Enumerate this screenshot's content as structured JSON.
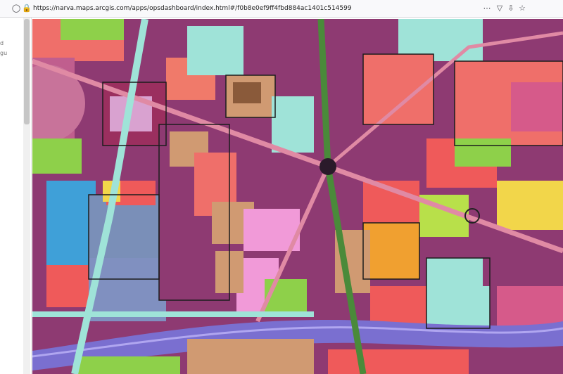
{
  "browser": {
    "url": "https://narva.maps.arcgis.com/apps/opsdashboard/index.html#/f0b8e0ef9ff4fbd884ac1401c514599",
    "icons": [
      "shield-icon",
      "lock-icon",
      "more-icon",
      "pocket-icon",
      "download-icon",
      "bookmark-star-icon"
    ]
  },
  "sidebar": {
    "text_line_1": "d",
    "text_line_2": "gu"
  },
  "map": {
    "type": "land-use map",
    "colors": {
      "residential": "#8e3a72",
      "commercial": "#ef6f6a",
      "industrial": "#3fa0d8",
      "public": "#e05a4a",
      "green": "#8ed04a",
      "water": "#9fe3d8",
      "roads": "#e08aa4",
      "railway": "#7a6fd0",
      "tan": "#d09a72",
      "pink": "#f19ad8",
      "yellow": "#f2d64a"
    }
  }
}
